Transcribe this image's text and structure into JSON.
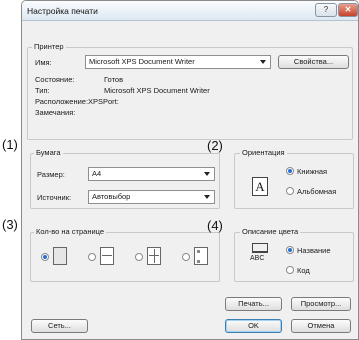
{
  "dialog": {
    "title": "Настройка печати",
    "help_button": "?",
    "close_button": "✕"
  },
  "printer": {
    "group_title": "Принтер",
    "name_label": "Имя:",
    "name_value": "Microsoft XPS Document Writer",
    "properties_button": "Свойства...",
    "status_label": "Состояние:",
    "status_value": "Готов",
    "type_label": "Тип:",
    "type_value": "Microsoft XPS Document Writer",
    "location_label": "Расположение:",
    "location_value": "XPSPort:",
    "comment_label": "Замечания:"
  },
  "markers": {
    "m1": "(1)",
    "m2": "(2)",
    "m3": "(3)",
    "m4": "(4)"
  },
  "paper": {
    "group_title": "Бумага",
    "size_label": "Размер:",
    "size_value": "A4",
    "source_label": "Источник:",
    "source_value": "Автовыбор"
  },
  "orientation": {
    "group_title": "Ориентация",
    "icon_letter": "A",
    "portrait": "Книжная",
    "landscape": "Альбомная",
    "selected": "portrait"
  },
  "pages_per_sheet": {
    "group_title": "Кол-во на странице",
    "options": [
      "1",
      "2",
      "4",
      "booklet"
    ],
    "selected": 0
  },
  "color": {
    "group_title": "Описание цвета",
    "icon_text": "ABC",
    "name_option": "Название",
    "code_option": "Код",
    "selected": "name"
  },
  "buttons": {
    "print": "Печать...",
    "preview": "Просмотр...",
    "network": "Сеть...",
    "ok": "OK",
    "cancel": "Отмена"
  }
}
